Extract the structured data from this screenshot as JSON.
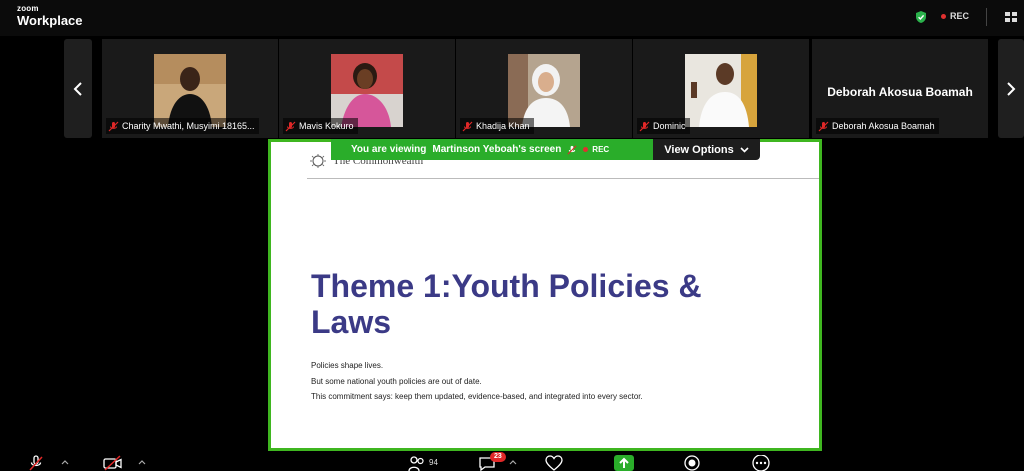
{
  "app": {
    "brand_small": "zoom",
    "brand_big": "Workplace",
    "rec_label": "REC"
  },
  "gallery": {
    "participants": [
      {
        "name": "Charity Mwathi, Musyimi 18165...",
        "muted": true
      },
      {
        "name": "Mavis Kokuro",
        "muted": true
      },
      {
        "name": "Khadija Khan",
        "muted": true
      },
      {
        "name": "Dominic",
        "muted": true
      },
      {
        "name": "Deborah Akosua Boamah",
        "muted": true,
        "display_name": "Deborah Akosua Boamah"
      }
    ]
  },
  "share": {
    "banner_prefix": "You are viewing",
    "banner_owner": "Martinson Yeboah's screen",
    "banner_rec": "REC",
    "view_options_label": "View Options"
  },
  "slide": {
    "org": "The Commonwealth",
    "title": "Theme 1:Youth Policies & Laws",
    "lines": [
      "Policies shape lives.",
      "But some national youth policies are out of date.",
      "This commitment says: keep them updated, evidence-based, and integrated into every sector."
    ]
  },
  "toolbar": {
    "participants_count": "94",
    "chat_badge": "23"
  },
  "colors": {
    "share_border": "#3fb620",
    "banner_green": "#2aad2a",
    "rec_red": "#e0302f",
    "title_purple": "#3b3a86"
  }
}
